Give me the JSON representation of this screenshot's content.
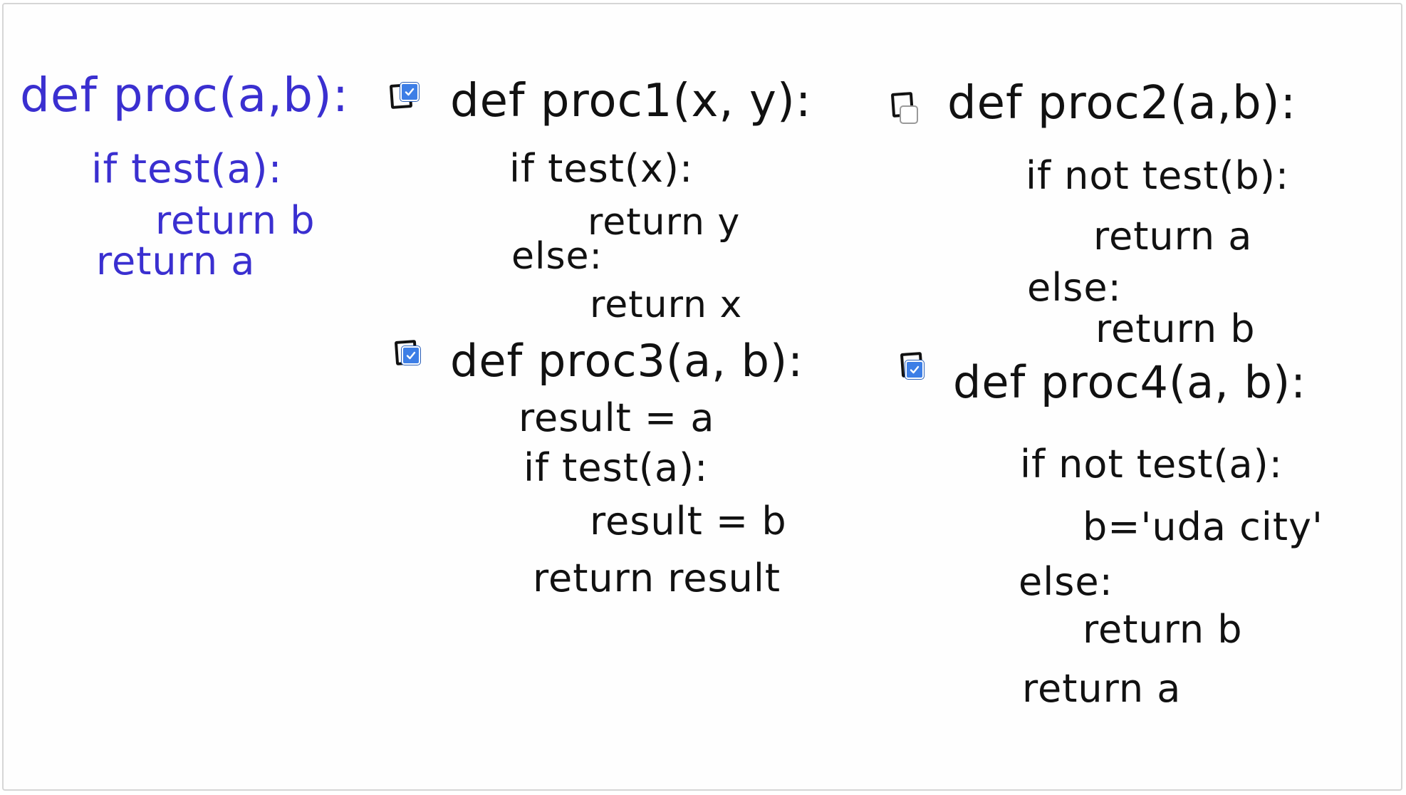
{
  "reference": {
    "lines": [
      "def proc(a,b):",
      "if test(a):",
      "return b",
      "return a"
    ]
  },
  "options": [
    {
      "id": "proc1",
      "checked": true,
      "lines": [
        "def proc1(x, y):",
        "if test(x):",
        "return y",
        "else:",
        "return x"
      ]
    },
    {
      "id": "proc2",
      "checked": false,
      "lines": [
        "def proc2(a,b):",
        "if not test(b):",
        "return a",
        "else:",
        "return b"
      ]
    },
    {
      "id": "proc3",
      "checked": true,
      "lines": [
        "def proc3(a, b):",
        "result = a",
        "if test(a):",
        "result = b",
        "return result"
      ]
    },
    {
      "id": "proc4",
      "checked": true,
      "lines": [
        "def proc4(a, b):",
        "if not test(a):",
        "b='uda city'",
        "else:",
        "return b",
        "return a"
      ]
    }
  ],
  "colors": {
    "reference_ink": "#3a2fd0",
    "option_ink": "#111111",
    "checkbox_fill": "#3d7ee6"
  }
}
